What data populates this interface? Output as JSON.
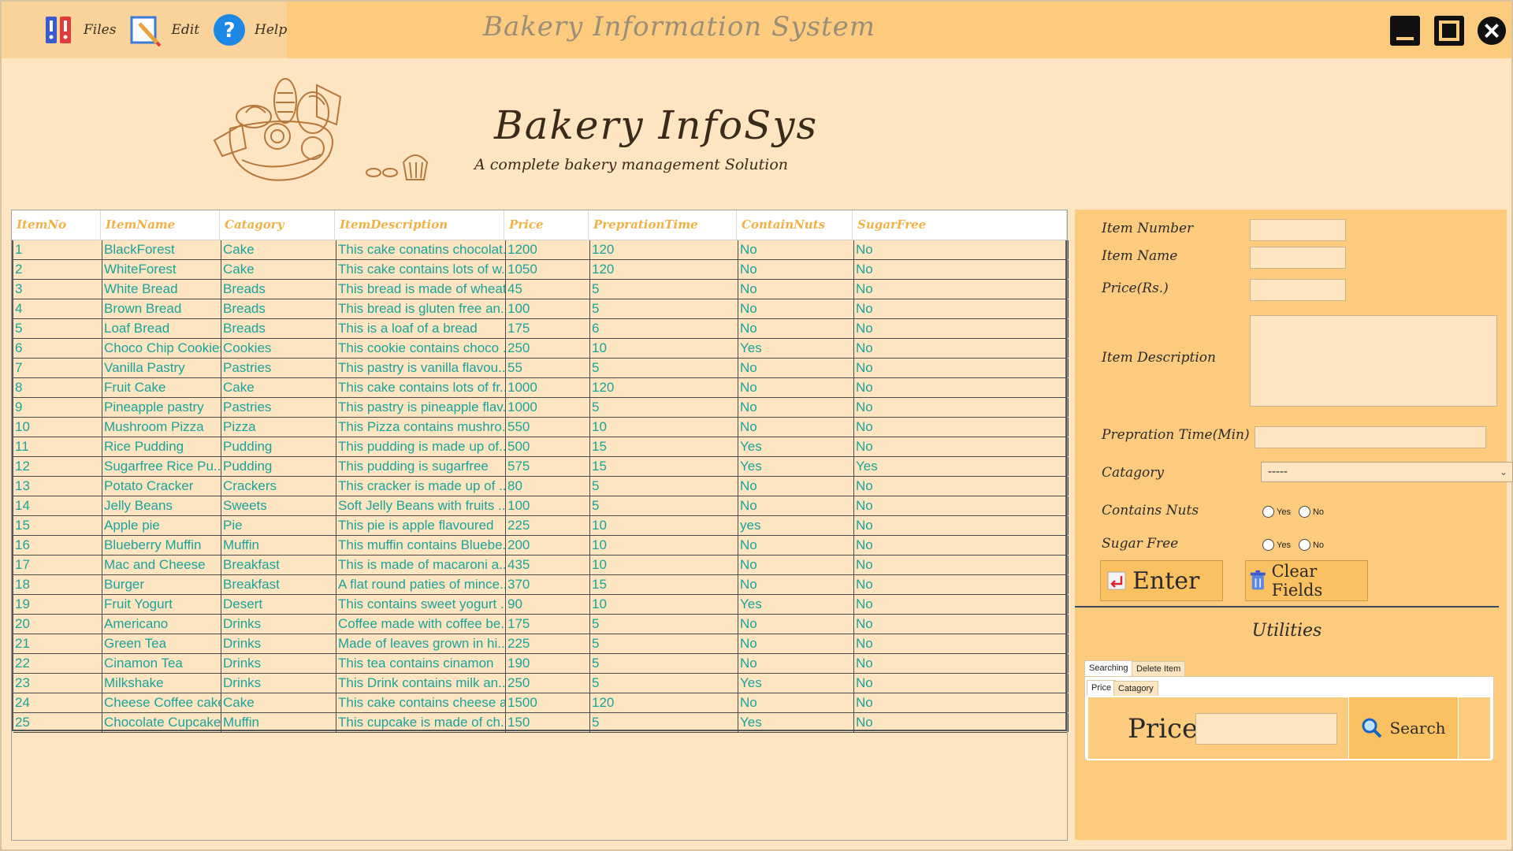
{
  "window": {
    "title": "Bakery Information System"
  },
  "menu": [
    {
      "label": "Files",
      "icon": "files-icon"
    },
    {
      "label": "Edit",
      "icon": "edit-icon"
    },
    {
      "label": "Help",
      "icon": "help-icon"
    }
  ],
  "banner": {
    "title": "Bakery InfoSys",
    "subtitle": "A complete bakery management Solution"
  },
  "table": {
    "columns": [
      "ItemNo",
      "ItemName",
      "Catagory",
      "ItemDescription",
      "Price",
      "PreprationTime",
      "ContainNuts",
      "SugarFree"
    ],
    "rows": [
      [
        "1",
        "BlackForest",
        "Cake",
        "This cake conatins chocolat...",
        "1200",
        "120",
        "No",
        "No"
      ],
      [
        "2",
        "WhiteForest",
        "Cake",
        "This cake contains lots of w...",
        "1050",
        "120",
        "No",
        "No"
      ],
      [
        "3",
        "White Bread",
        "Breads",
        "This bread is made  of wheat",
        "45",
        "5",
        "No",
        "No"
      ],
      [
        "4",
        "Brown Bread",
        "Breads",
        "This bread is gluten free an...",
        "100",
        "5",
        "No",
        "No"
      ],
      [
        "5",
        "Loaf Bread",
        "Breads",
        "This is a loaf of a bread",
        "175",
        "6",
        "No",
        "No"
      ],
      [
        "6",
        "Choco Chip Cookies",
        "Cookies",
        "This cookie contains choco ...",
        "250",
        "10",
        "Yes",
        "No"
      ],
      [
        "7",
        "Vanilla Pastry",
        "Pastries",
        "This pastry is  vanilla flavou...",
        "55",
        "5",
        "No",
        "No"
      ],
      [
        "8",
        "Fruit Cake",
        "Cake",
        "This cake contains lots of fr...",
        "1000",
        "120",
        "No",
        "No"
      ],
      [
        "9",
        "Pineapple pastry",
        "Pastries",
        "This pastry is pineapple flav...",
        "1000",
        "5",
        "No",
        "No"
      ],
      [
        "10",
        "Mushroom Pizza",
        "Pizza",
        "This Pizza contains mushro...",
        "550",
        "10",
        "No",
        "No"
      ],
      [
        "11",
        "Rice Pudding",
        "Pudding",
        "This pudding is made up of...",
        "500",
        "15",
        "Yes",
        "No"
      ],
      [
        "12",
        "Sugarfree Rice Pu...",
        "Pudding",
        "This pudding is sugarfree",
        "575",
        "15",
        "Yes",
        "Yes"
      ],
      [
        "13",
        "Potato Cracker",
        "Crackers",
        " This cracker is made up of ...",
        "80",
        "5",
        "No",
        "No"
      ],
      [
        "14",
        "Jelly Beans",
        "Sweets",
        "Soft Jelly Beans with fruits ...",
        "100",
        "5",
        "No",
        "No"
      ],
      [
        "15",
        "Apple pie",
        "Pie",
        "This pie is apple flavoured",
        "225",
        "10",
        "yes",
        "No"
      ],
      [
        "16",
        "Blueberry Muffin",
        "Muffin",
        "This muffin contains Bluebe...",
        "200",
        "10",
        "No",
        "No"
      ],
      [
        "17",
        "Mac and Cheese",
        "Breakfast",
        "This is made of macaroni a...",
        "435",
        "10",
        "No",
        "No"
      ],
      [
        "18",
        "Burger",
        "Breakfast",
        "A flat round paties of mince...",
        "370",
        "15",
        "No",
        "No"
      ],
      [
        "19",
        "Fruit Yogurt",
        "Desert",
        "This contains sweet yogurt ...",
        "90",
        "10",
        "Yes",
        "No"
      ],
      [
        "20",
        "Americano",
        "Drinks",
        "Coffee made with coffee be...",
        "175",
        "5",
        "No",
        "No"
      ],
      [
        "21",
        "Green Tea",
        "Drinks",
        "Made of leaves grown in hi...",
        "225",
        "5",
        "No",
        "No"
      ],
      [
        "22",
        "Cinamon Tea",
        "Drinks",
        "This tea contains cinamon",
        "190",
        "5",
        "No",
        "No"
      ],
      [
        "23",
        "Milkshake",
        "Drinks",
        "This Drink contains milk an...",
        "250",
        "5",
        "Yes",
        "No"
      ],
      [
        "24",
        "Cheese Coffee cake",
        "Cake",
        "This cake contains cheese a...",
        "1500",
        "120",
        "No",
        "No"
      ],
      [
        "25",
        "Chocolate Cupcake",
        "Muffin",
        "This cupcake is made of ch...",
        "150",
        "5",
        "Yes",
        "No"
      ]
    ]
  },
  "form": {
    "item_number_label": "Item Number",
    "item_name_label": "Item Name",
    "price_label": "Price(Rs.)",
    "description_label": "Item Description",
    "prep_time_label": "Prepration Time(Min)",
    "category_label": "Catagory",
    "category_value": "-----",
    "nuts_label": "Contains Nuts",
    "sugar_label": "Sugar Free",
    "yes_label": "Yes",
    "no_label": "No",
    "enter_label": "Enter",
    "clear_label": "Clear Fields"
  },
  "utilities": {
    "title": "Utilities",
    "tabs": [
      "Searching",
      "Delete Item"
    ],
    "subtabs": [
      "Price",
      "Catagory"
    ],
    "price_label": "Price",
    "search_label": "Search"
  },
  "colors": {
    "accent": "#fdcb7e",
    "background": "#fde5c1",
    "cell_text": "#1aa39b",
    "header_text": "#f0b244"
  }
}
